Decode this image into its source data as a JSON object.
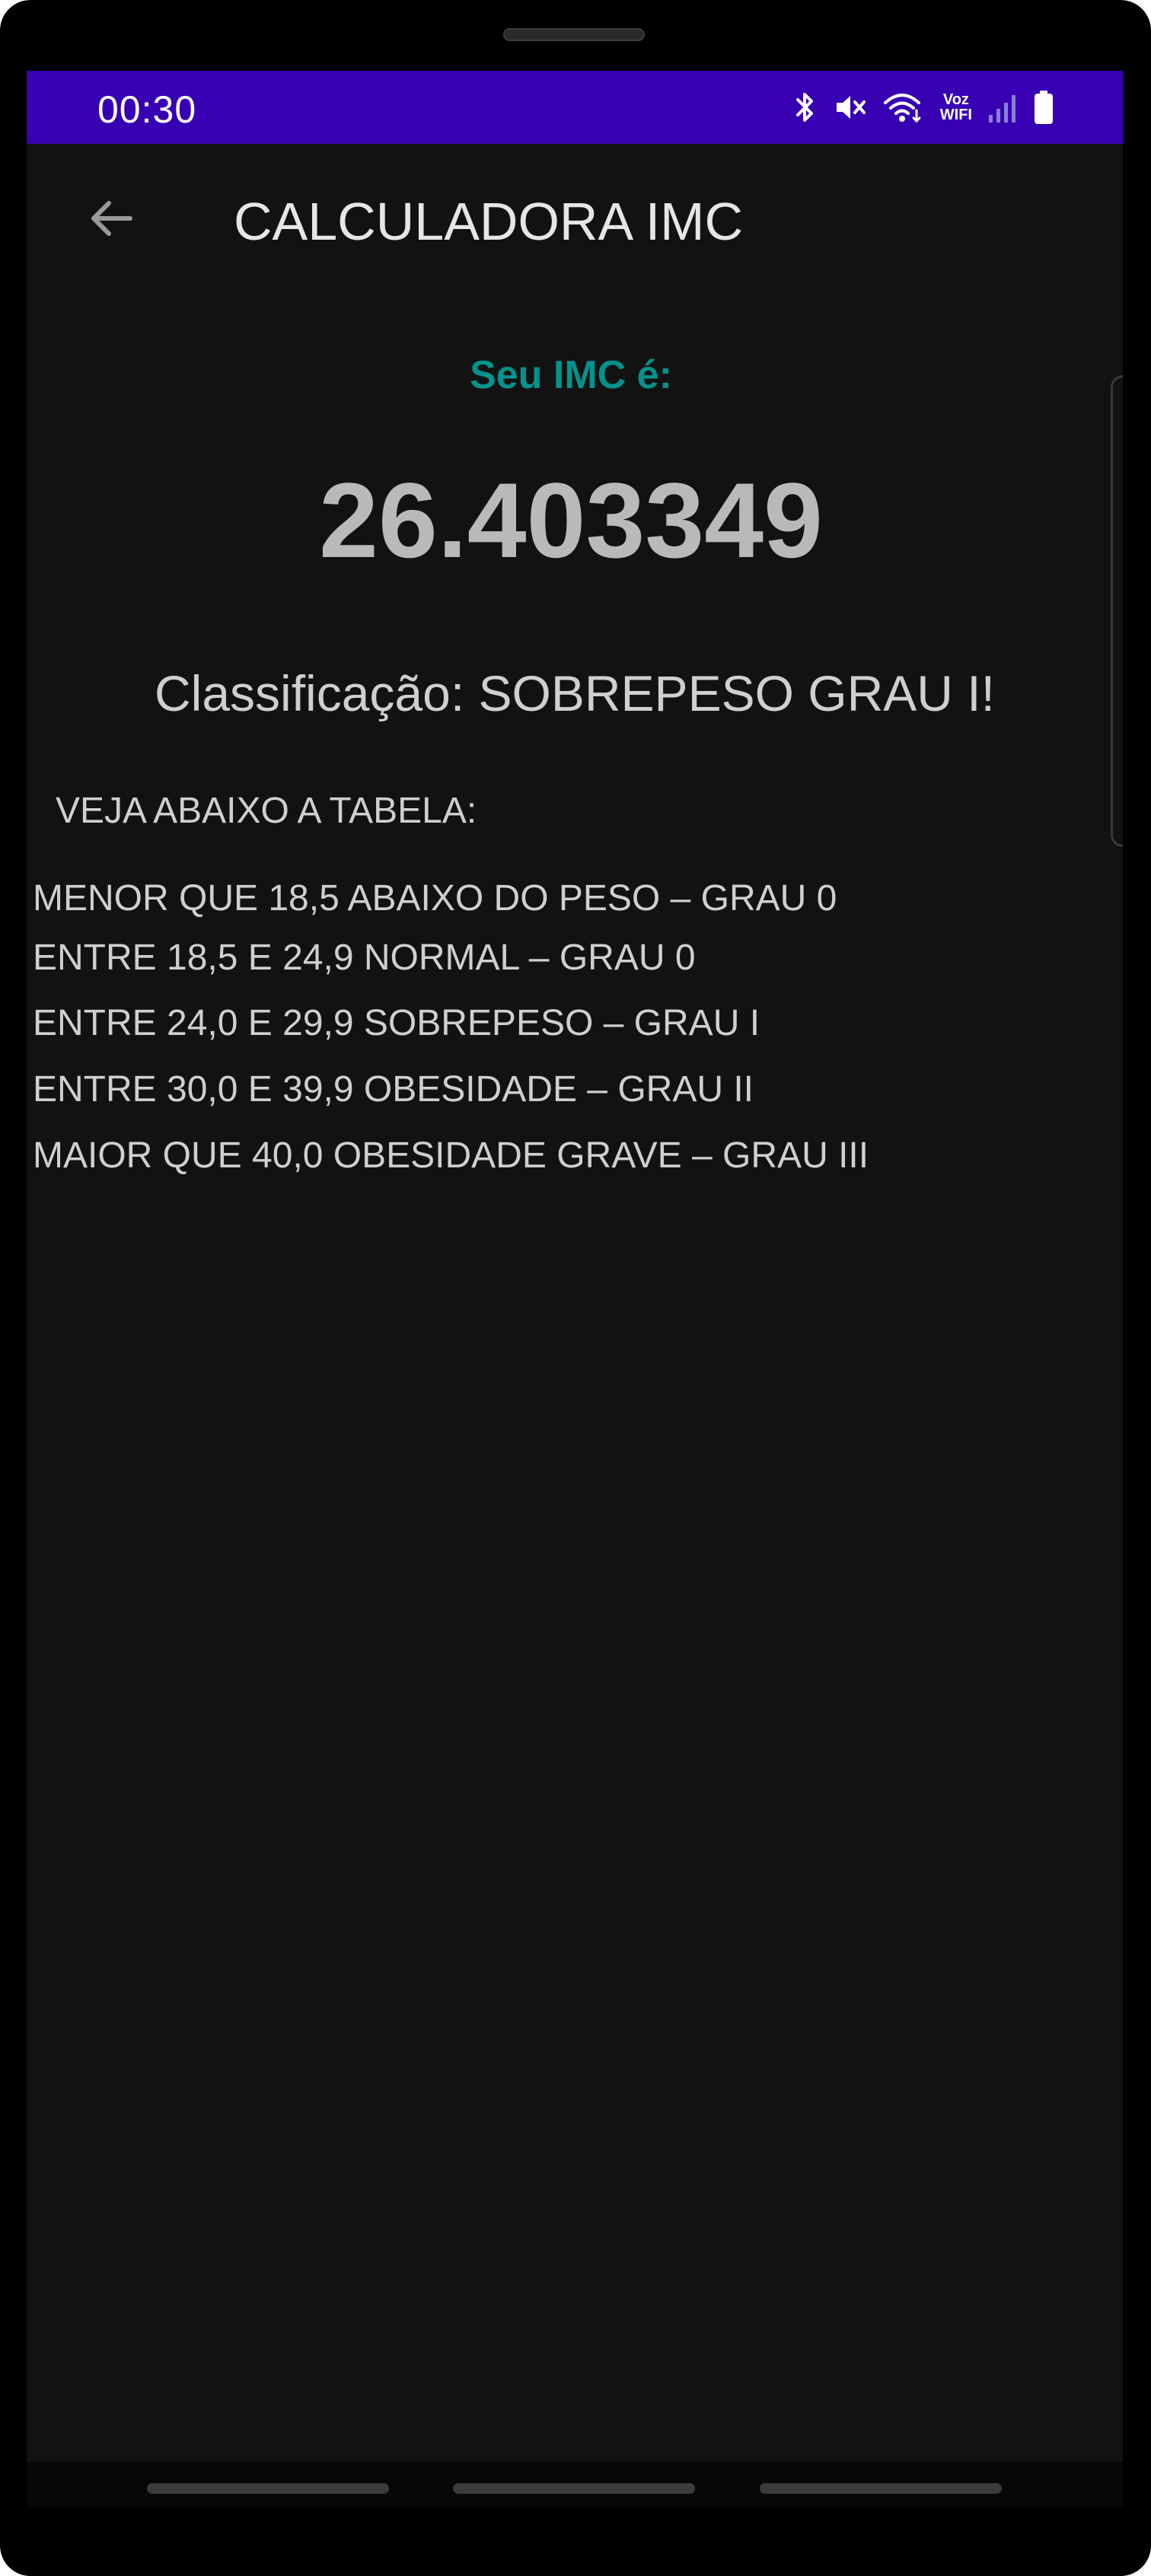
{
  "status_bar": {
    "time": "00:30",
    "voz_label": "Voz",
    "wifi_label": "WIFI",
    "icons": [
      "bluetooth-icon",
      "mute-icon",
      "wifi-calling-icon",
      "signal-icon",
      "battery-icon"
    ],
    "background_color": "#3700b3"
  },
  "app_bar": {
    "title": "CALCULADORA IMC",
    "back_icon": "arrow-left-icon"
  },
  "result": {
    "label": "Seu IMC é:",
    "value": "26.403349",
    "classification": "Classificação: SOBREPESO GRAU I!",
    "label_color": "#03928c"
  },
  "table": {
    "heading": "VEJA ABAIXO A TABELA:",
    "rows": [
      "MENOR QUE 18,5 ABAIXO DO PESO – GRAU 0",
      "ENTRE 18,5 E 24,9 NORMAL – GRAU 0",
      "ENTRE 24,0 E 29,9 SOBREPESO – GRAU I",
      "ENTRE 30,0 E 39,9 OBESIDADE – GRAU II",
      "MAIOR QUE 40,0 OBESIDADE GRAVE – GRAU III"
    ]
  }
}
